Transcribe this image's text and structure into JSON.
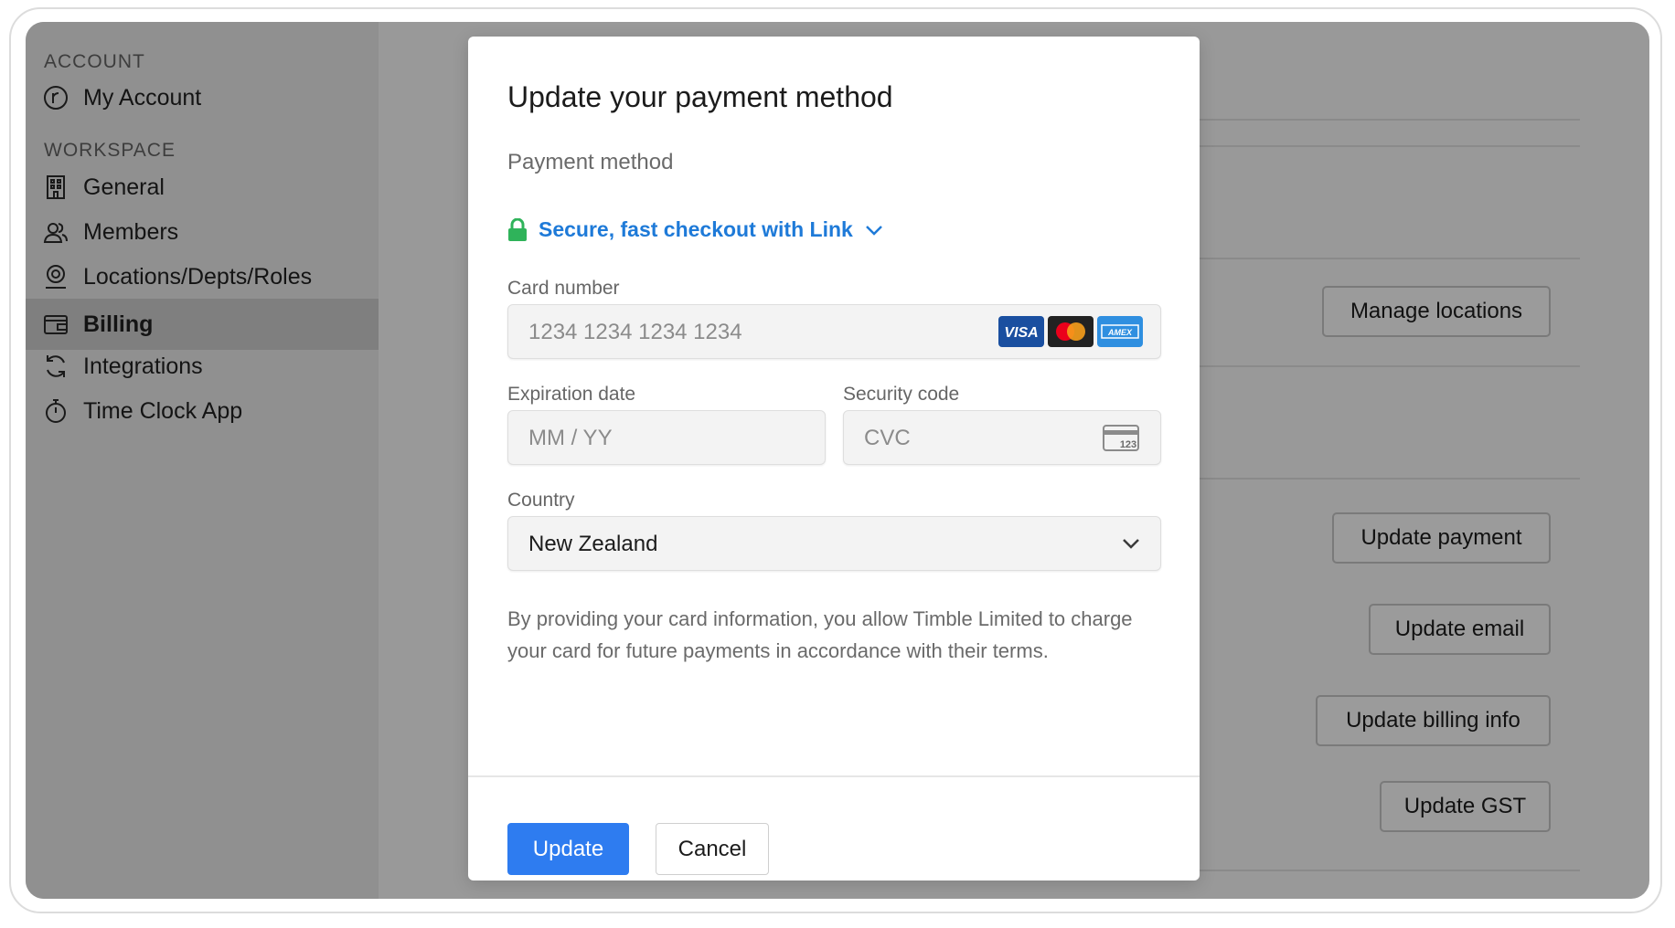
{
  "sidebar": {
    "account_label": "ACCOUNT",
    "workspace_label": "WORKSPACE",
    "items": [
      {
        "label": "My Account",
        "icon": "account-circle-icon"
      },
      {
        "label": "General",
        "icon": "building-icon"
      },
      {
        "label": "Members",
        "icon": "members-icon"
      },
      {
        "label": "Locations/Depts/Roles",
        "icon": "location-pin-icon"
      },
      {
        "label": "Billing",
        "icon": "wallet-icon",
        "active": true
      },
      {
        "label": "Integrations",
        "icon": "sync-icon"
      },
      {
        "label": "Time Clock App",
        "icon": "stopwatch-icon"
      }
    ]
  },
  "background": {
    "manage_locations": "Manage locations",
    "update_payment": "Update payment",
    "update_email": "Update email",
    "update_billing_info": "Update billing info",
    "update_gst": "Update GST"
  },
  "modal": {
    "title": "Update your payment method",
    "subheading": "Payment method",
    "link_checkout": "Secure, fast checkout with Link",
    "card_number": {
      "label": "Card number",
      "placeholder": "1234 1234 1234 1234"
    },
    "card_brands": [
      "VISA",
      "Mastercard",
      "AMEX"
    ],
    "expiration": {
      "label": "Expiration date",
      "placeholder": "MM / YY"
    },
    "security": {
      "label": "Security code",
      "placeholder": "CVC",
      "icon_text": "123"
    },
    "country": {
      "label": "Country",
      "value": "New Zealand"
    },
    "disclaimer": "By providing your card information, you allow Timble Limited to charge your card for future payments in accordance with their terms.",
    "update_button": "Update",
    "cancel_button": "Cancel"
  },
  "colors": {
    "accent": "#2e7cf0",
    "link": "#1e7ad8",
    "lock": "#2fb35a",
    "visa": "#1a4fa0",
    "amex": "#2f8fe0"
  }
}
